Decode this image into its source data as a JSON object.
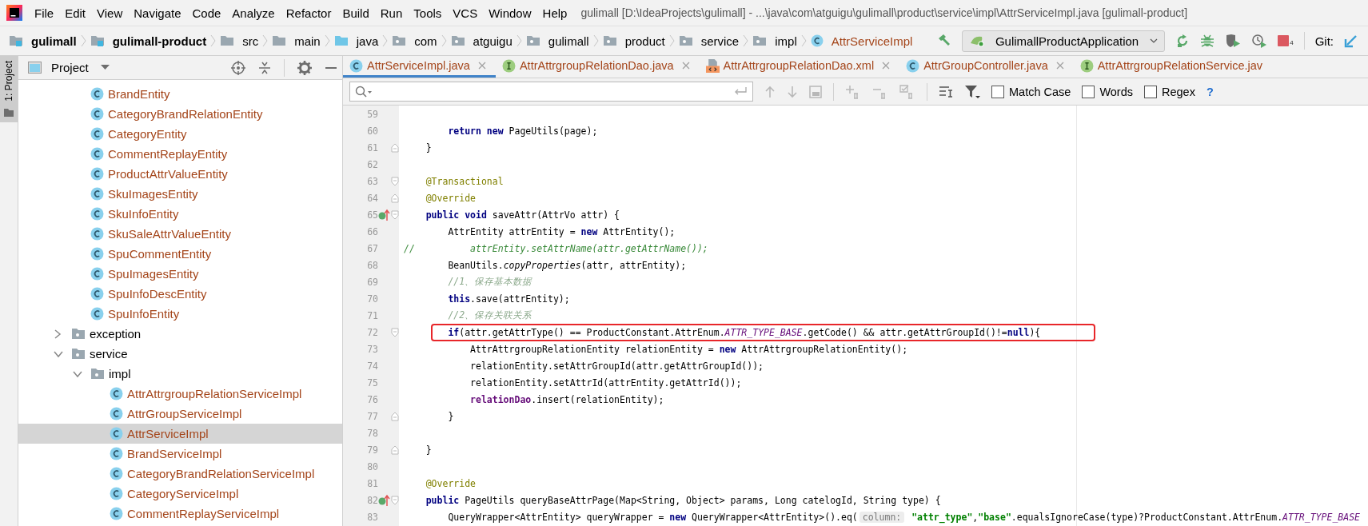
{
  "window": {
    "title": "gulimall [D:\\IdeaProjects\\gulimall] - ...\\java\\com\\atguigu\\gulimall\\product\\service\\impl\\AttrServiceImpl.java [gulimall-product]"
  },
  "menu": [
    "File",
    "Edit",
    "View",
    "Navigate",
    "Code",
    "Analyze",
    "Refactor",
    "Build",
    "Run",
    "Tools",
    "VCS",
    "Window",
    "Help"
  ],
  "breadcrumbs": [
    {
      "label": "gulimall",
      "kind": "module"
    },
    {
      "label": "gulimall-product",
      "kind": "module"
    },
    {
      "label": "src",
      "kind": "folder"
    },
    {
      "label": "main",
      "kind": "folder"
    },
    {
      "label": "java",
      "kind": "source"
    },
    {
      "label": "com",
      "kind": "package"
    },
    {
      "label": "atguigu",
      "kind": "package"
    },
    {
      "label": "gulimall",
      "kind": "package"
    },
    {
      "label": "product",
      "kind": "package"
    },
    {
      "label": "service",
      "kind": "package"
    },
    {
      "label": "impl",
      "kind": "package"
    },
    {
      "label": "AttrServiceImpl",
      "kind": "class"
    }
  ],
  "toolbar": {
    "run_configuration": "GulimallProductApplication",
    "stop_count": "4",
    "vcs_label": "Git:"
  },
  "side_tab": {
    "label": "1: Project",
    "selected": true
  },
  "project": {
    "title": "Project",
    "tree": [
      {
        "children": [
          {
            "label": "BrandEntity",
            "kind": "class",
            "selected": false
          },
          {
            "label": "CategoryBrandRelationEntity",
            "kind": "class",
            "selected": false
          },
          {
            "label": "CategoryEntity",
            "kind": "class",
            "selected": false
          },
          {
            "label": "CommentReplayEntity",
            "kind": "class",
            "selected": false
          },
          {
            "label": "ProductAttrValueEntity",
            "kind": "class",
            "selected": false
          },
          {
            "label": "SkuImagesEntity",
            "kind": "class",
            "selected": false
          },
          {
            "label": "SkuInfoEntity",
            "kind": "class",
            "selected": false
          },
          {
            "label": "SkuSaleAttrValueEntity",
            "kind": "class",
            "selected": false
          },
          {
            "label": "SpuCommentEntity",
            "kind": "class",
            "selected": false
          },
          {
            "label": "SpuImagesEntity",
            "kind": "class",
            "selected": false
          },
          {
            "label": "SpuInfoDescEntity",
            "kind": "class",
            "selected": false
          },
          {
            "label": "SpuInfoEntity",
            "kind": "class",
            "selected": false
          }
        ]
      },
      {
        "label": "exception",
        "kind": "folder",
        "expanded": false,
        "selected": false
      },
      {
        "label": "service",
        "kind": "folder",
        "expanded": true,
        "selected": false,
        "children": [
          {
            "label": "impl",
            "kind": "folder",
            "expanded": true,
            "selected": false,
            "children": [
              {
                "label": "AttrAttrgroupRelationServiceImpl",
                "kind": "class",
                "selected": false
              },
              {
                "label": "AttrGroupServiceImpl",
                "kind": "class",
                "selected": false
              },
              {
                "label": "AttrServiceImpl",
                "kind": "class",
                "selected": true
              },
              {
                "label": "BrandServiceImpl",
                "kind": "class",
                "selected": false
              },
              {
                "label": "CategoryBrandRelationServiceImpl",
                "kind": "class",
                "selected": false
              },
              {
                "label": "CategoryServiceImpl",
                "kind": "class",
                "selected": false
              },
              {
                "label": "CommentReplayServiceImpl",
                "kind": "class",
                "selected": false
              }
            ]
          }
        ]
      }
    ]
  },
  "tabs": [
    {
      "label": "AttrServiceImpl.java",
      "kind": "class",
      "selected": true,
      "closable": true
    },
    {
      "label": "AttrAttrgroupRelationDao.java",
      "kind": "interface",
      "selected": false,
      "closable": true
    },
    {
      "label": "AttrAttrgroupRelationDao.xml",
      "kind": "xml",
      "selected": false,
      "closable": true
    },
    {
      "label": "AttrGroupController.java",
      "kind": "class",
      "selected": false,
      "closable": true
    },
    {
      "label": "AttrAttrgroupRelationService.jav",
      "kind": "interface",
      "selected": false,
      "closable": false
    }
  ],
  "find": {
    "options": [
      {
        "label": "Match Case",
        "checked": false
      },
      {
        "label": "Words",
        "checked": false
      },
      {
        "label": "Regex",
        "checked": false
      }
    ],
    "help": "?"
  },
  "code_lines": [
    {
      "number": "59",
      "marker": false,
      "highlighted": false
    },
    {
      "number": "60",
      "marker": false,
      "highlighted": false,
      "tokens": [
        {
          "kind": "keyword",
          "text": "        return"
        },
        {
          "kind": "keyword",
          "text": " new"
        },
        {
          "kind": "plain",
          "text": " PageUtils(page);"
        }
      ]
    },
    {
      "number": "61",
      "kind": "fold_end",
      "marker": false,
      "highlighted": false,
      "tokens": [
        {
          "kind": "plain",
          "text": "    }"
        }
      ]
    },
    {
      "number": "62",
      "marker": false,
      "highlighted": false
    },
    {
      "number": "63",
      "kind": "fold_start",
      "marker": false,
      "highlighted": false,
      "tokens": [
        {
          "kind": "annotation",
          "text": "    @Transactional"
        }
      ]
    },
    {
      "number": "64",
      "kind": "fold_end",
      "marker": false,
      "highlighted": false,
      "tokens": [
        {
          "kind": "annotation",
          "text": "    @Override"
        }
      ]
    },
    {
      "number": "65",
      "kind": "fold_start",
      "marker": true,
      "highlighted": false,
      "tokens": [
        {
          "kind": "keyword",
          "text": "    public"
        },
        {
          "kind": "keyword",
          "text": " void"
        },
        {
          "kind": "plain",
          "text": " saveAttr(AttrVo attr) {"
        }
      ]
    },
    {
      "number": "66",
      "marker": false,
      "highlighted": false,
      "tokens": [
        {
          "kind": "plain",
          "text": "        AttrEntity attrEntity = "
        },
        {
          "kind": "keyword",
          "text": "new"
        },
        {
          "kind": "plain",
          "text": " AttrEntity();"
        }
      ]
    },
    {
      "number": "67",
      "marker": false,
      "highlighted": false,
      "tokens": [
        {
          "kind": "disabled",
          "text": "//          attrEntity.setAttrName(attr.getAttrName());"
        }
      ]
    },
    {
      "number": "68",
      "marker": false,
      "highlighted": false,
      "tokens": [
        {
          "kind": "plain",
          "text": "        BeanUtils."
        },
        {
          "kind": "static",
          "text": "copyProperties"
        },
        {
          "kind": "plain",
          "text": "(attr, attrEntity);"
        }
      ]
    },
    {
      "number": "69",
      "marker": false,
      "highlighted": false,
      "tokens": [
        {
          "kind": "comment",
          "text": "        //1、保存基本数据"
        }
      ]
    },
    {
      "number": "70",
      "marker": false,
      "highlighted": false,
      "tokens": [
        {
          "kind": "keyword",
          "text": "        this"
        },
        {
          "kind": "plain",
          "text": ".save(attrEntity);"
        }
      ]
    },
    {
      "number": "71",
      "marker": false,
      "highlighted": false,
      "tokens": [
        {
          "kind": "comment",
          "text": "        //2、保存关联关系"
        }
      ]
    },
    {
      "number": "72",
      "kind": "fold_start",
      "marker": false,
      "highlighted": true,
      "tokens": [
        {
          "kind": "keyword",
          "text": "        if"
        },
        {
          "kind": "plain",
          "text": "(attr.getAttrType() == ProductConstant.AttrEnum."
        },
        {
          "kind": "constant",
          "text": "ATTR_TYPE_BASE"
        },
        {
          "kind": "plain",
          "text": ".getCode() && attr.getAttrGroupId()!="
        },
        {
          "kind": "keyword",
          "text": "null"
        },
        {
          "kind": "plain",
          "text": "){"
        }
      ]
    },
    {
      "number": "73",
      "marker": false,
      "highlighted": false,
      "tokens": [
        {
          "kind": "plain",
          "text": "            AttrAttrgroupRelationEntity relationEntity = "
        },
        {
          "kind": "keyword",
          "text": "new"
        },
        {
          "kind": "plain",
          "text": " AttrAttrgroupRelationEntity();"
        }
      ]
    },
    {
      "number": "74",
      "marker": false,
      "highlighted": false,
      "tokens": [
        {
          "kind": "plain",
          "text": "            relationEntity.setAttrGroupId(attr.getAttrGroupId());"
        }
      ]
    },
    {
      "number": "75",
      "marker": false,
      "highlighted": false,
      "tokens": [
        {
          "kind": "plain",
          "text": "            relationEntity.setAttrId(attrEntity.getAttrId());"
        }
      ]
    },
    {
      "number": "76",
      "marker": false,
      "highlighted": false,
      "tokens": [
        {
          "kind": "field",
          "text": "            relationDao"
        },
        {
          "kind": "plain",
          "text": ".insert(relationEntity);"
        }
      ]
    },
    {
      "number": "77",
      "kind": "fold_end",
      "marker": false,
      "highlighted": false,
      "tokens": [
        {
          "kind": "plain",
          "text": "        }"
        }
      ]
    },
    {
      "number": "78",
      "marker": false,
      "highlighted": false
    },
    {
      "number": "79",
      "kind": "fold_end",
      "marker": false,
      "highlighted": false,
      "tokens": [
        {
          "kind": "plain",
          "text": "    }"
        }
      ]
    },
    {
      "number": "80",
      "marker": false,
      "highlighted": false
    },
    {
      "number": "81",
      "marker": false,
      "highlighted": false,
      "tokens": [
        {
          "kind": "annotation",
          "text": "    @Override"
        }
      ]
    },
    {
      "number": "82",
      "kind": "fold_start",
      "marker": true,
      "highlighted": false,
      "tokens": [
        {
          "kind": "keyword",
          "text": "    public"
        },
        {
          "kind": "plain",
          "text": " PageUtils queryBaseAttrPage(Map<String, Object> params, Long catelogId, String type) {"
        }
      ]
    },
    {
      "number": "83",
      "marker": false,
      "highlighted": false,
      "tokens": [
        {
          "kind": "plain",
          "text": "        QueryWrapper<AttrEntity> queryWrapper = "
        },
        {
          "kind": "keyword",
          "text": "new"
        },
        {
          "kind": "plain",
          "text": " QueryWrapper<AttrEntity>().eq("
        },
        {
          "kind": "hint",
          "text": "column:"
        },
        {
          "kind": "string",
          "text": " \"attr_type\""
        },
        {
          "kind": "plain",
          "text": ","
        },
        {
          "kind": "string",
          "text": "\"base\""
        },
        {
          "kind": "plain",
          "text": ".equalsIgnoreCase(type)?ProductConstant.AttrEnum."
        },
        {
          "kind": "constant",
          "text": "ATTR_TYPE_BASE"
        }
      ]
    }
  ]
}
